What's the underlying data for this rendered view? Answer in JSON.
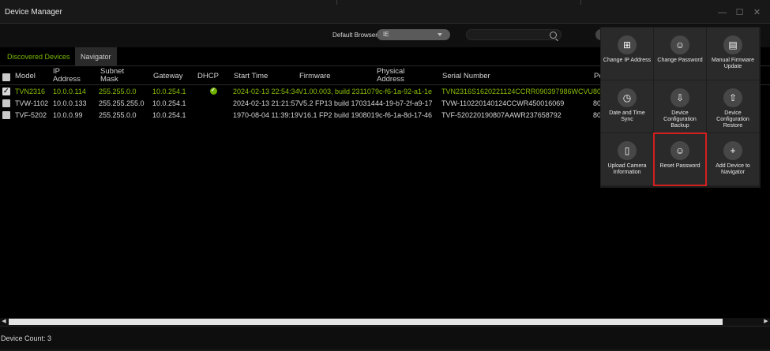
{
  "window": {
    "title": "Device Manager"
  },
  "toolbar": {
    "default_browser_label": "Default Browser",
    "browser_value": "IE",
    "search_value": ""
  },
  "tabs": [
    {
      "label": "Discovered Devices"
    },
    {
      "label": "Navigator"
    }
  ],
  "columns": [
    "Model",
    "IP Address",
    "Subnet Mask",
    "Gateway",
    "DHCP",
    "Start Time",
    "Firmware",
    "Physical Address",
    "Serial Number",
    "Po"
  ],
  "rows": [
    {
      "checked": true,
      "selected": true,
      "model": "TVN2316",
      "ip": "10.0.0.114",
      "mask": "255.255.0.0",
      "gateway": "10.0.254.1",
      "dhcp": true,
      "start": "2024-02-13 22:54:34",
      "firmware": "V1.00.003, build 231107",
      "mac": "9c-f6-1a-92-a1-1e",
      "serial": "TVN2316S1620221124CCRR090397986WCVU",
      "port": "80"
    },
    {
      "checked": false,
      "selected": false,
      "model": "TVW-1102",
      "ip": "10.0.0.133",
      "mask": "255.255.255.0",
      "gateway": "10.0.254.1",
      "dhcp": false,
      "start": "2024-02-13 21:21:57",
      "firmware": "V5.2 FP13 build 170314",
      "mac": "44-19-b7-2f-a9-17",
      "serial": "TVW-110220140124CCWR450016069",
      "port": "80"
    },
    {
      "checked": false,
      "selected": false,
      "model": "TVF-5202",
      "ip": "10.0.0.99",
      "mask": "255.255.0.0",
      "gateway": "10.0.254.1",
      "dhcp": false,
      "start": "1970-08-04 11:39:19",
      "firmware": "V16.1 FP2 build 190801",
      "mac": "9c-f6-1a-8d-17-46",
      "serial": "TVF-520220190807AAWR237658792",
      "port": "80"
    }
  ],
  "action_panel": {
    "tiles": [
      {
        "label": "Change IP Address",
        "icon": "network-icon"
      },
      {
        "label": "Change Password",
        "icon": "user-key-icon"
      },
      {
        "label": "Manual Firmware Update",
        "icon": "firmware-update-icon"
      },
      {
        "label": "Date and Time Sync",
        "icon": "calendar-clock-icon"
      },
      {
        "label": "Device Configuration Backup",
        "icon": "download-config-icon"
      },
      {
        "label": "Device Configuration Restore",
        "icon": "upload-config-icon"
      },
      {
        "label": "Upload Camera Information",
        "icon": "document-icon"
      },
      {
        "label": "Reset Password",
        "icon": "user-reset-icon",
        "highlighted": true
      },
      {
        "label": "Add Device to Navigator",
        "icon": "add-device-icon"
      }
    ]
  },
  "status": {
    "device_count": "Device Count: 3"
  },
  "colors": {
    "accent_green": "#7ab800",
    "highlight_red": "#d41f1f",
    "background": "#000000"
  }
}
